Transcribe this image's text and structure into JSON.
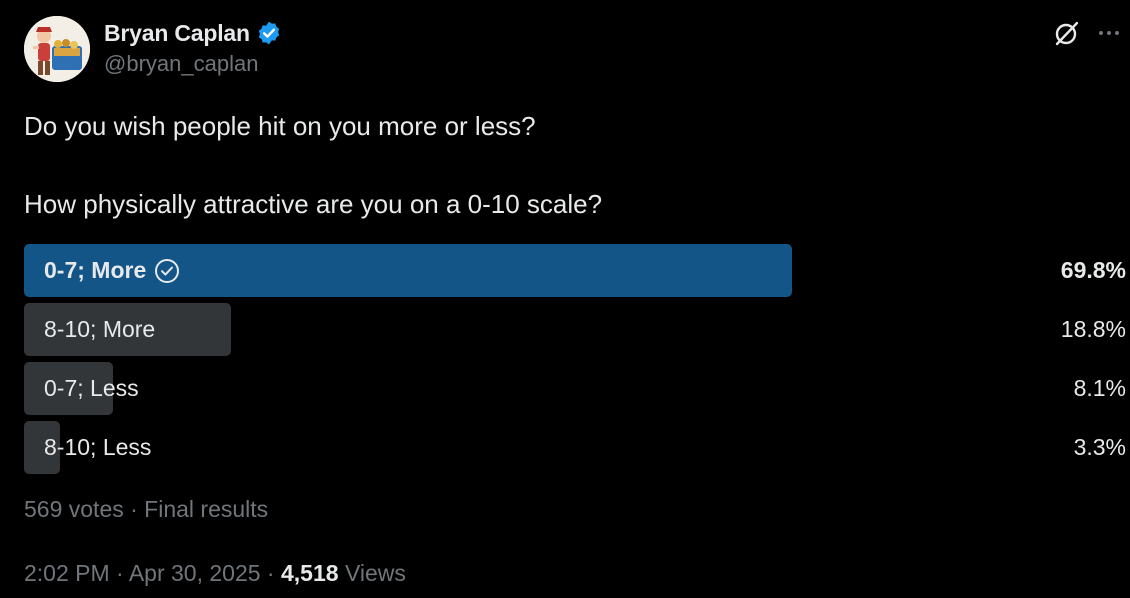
{
  "author": {
    "display_name": "Bryan Caplan",
    "handle": "@bryan_caplan",
    "verified": true,
    "verified_color": "#1d9bf0"
  },
  "header_icons": {
    "grok": "grok-icon",
    "more": "more-icon"
  },
  "tweet": {
    "lines": [
      "Do you wish people hit on you more or less?",
      "",
      "How physically attractive are you on a 0-10 scale?"
    ]
  },
  "poll": {
    "options": [
      {
        "label": "0-7; More",
        "percent_text": "69.8%",
        "percent": 69.8,
        "winner": true
      },
      {
        "label": "8-10; More",
        "percent_text": "18.8%",
        "percent": 18.8,
        "winner": false
      },
      {
        "label": "0-7; Less",
        "percent_text": "8.1%",
        "percent": 8.1,
        "winner": false
      },
      {
        "label": "8-10; Less",
        "percent_text": "3.3%",
        "percent": 3.3,
        "winner": false
      }
    ],
    "footer": "569 votes · Final results",
    "colors": {
      "winner_bar": "#135587",
      "other_bar": "#333639"
    }
  },
  "meta": {
    "time": "2:02 PM",
    "separator": " · ",
    "date": "Apr 30, 2025",
    "views_count": "4,518",
    "views_label": "Views"
  }
}
